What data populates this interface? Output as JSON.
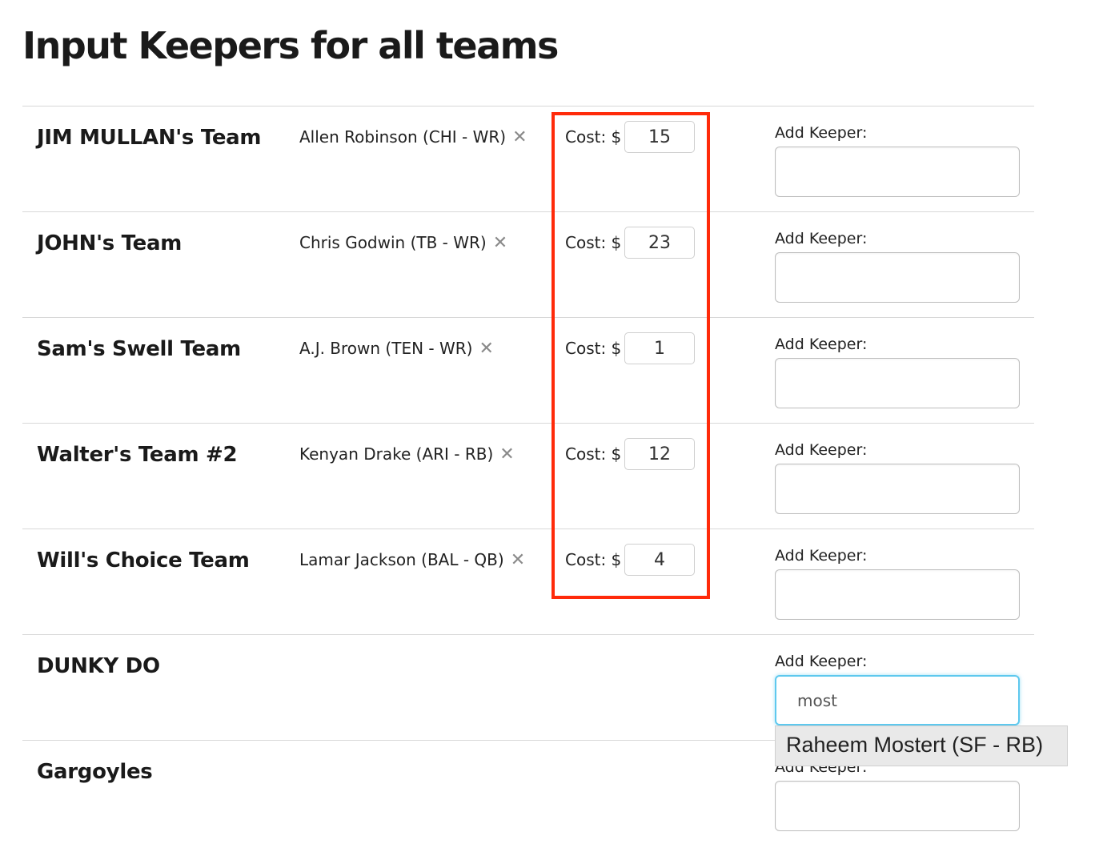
{
  "page": {
    "title": "Input Keepers for all teams"
  },
  "labels": {
    "cost": "Cost: $",
    "add_keeper": "Add Keeper:"
  },
  "icons": {
    "remove": "✕"
  },
  "colors": {
    "highlight": "#ff2a0a",
    "focus": "#5ec8ee"
  },
  "teams": [
    {
      "name": "JIM MULLAN's Team",
      "keeper": "Allen Robinson (CHI - WR)",
      "cost": "15",
      "add_value": ""
    },
    {
      "name": "JOHN's Team",
      "keeper": "Chris Godwin (TB - WR)",
      "cost": "23",
      "add_value": ""
    },
    {
      "name": "Sam's Swell Team",
      "keeper": "A.J. Brown (TEN - WR)",
      "cost": "1",
      "add_value": ""
    },
    {
      "name": "Walter's Team #2",
      "keeper": "Kenyan Drake (ARI - RB)",
      "cost": "12",
      "add_value": ""
    },
    {
      "name": "Will's Choice Team",
      "keeper": "Lamar Jackson (BAL - QB)",
      "cost": "4",
      "add_value": ""
    },
    {
      "name": "DUNKY DO",
      "keeper": null,
      "cost": null,
      "add_value": "most"
    },
    {
      "name": "Gargoyles",
      "keeper": null,
      "cost": null,
      "add_value": ""
    }
  ],
  "autocomplete": {
    "suggestion": "Raheem Mostert (SF - RB)"
  }
}
